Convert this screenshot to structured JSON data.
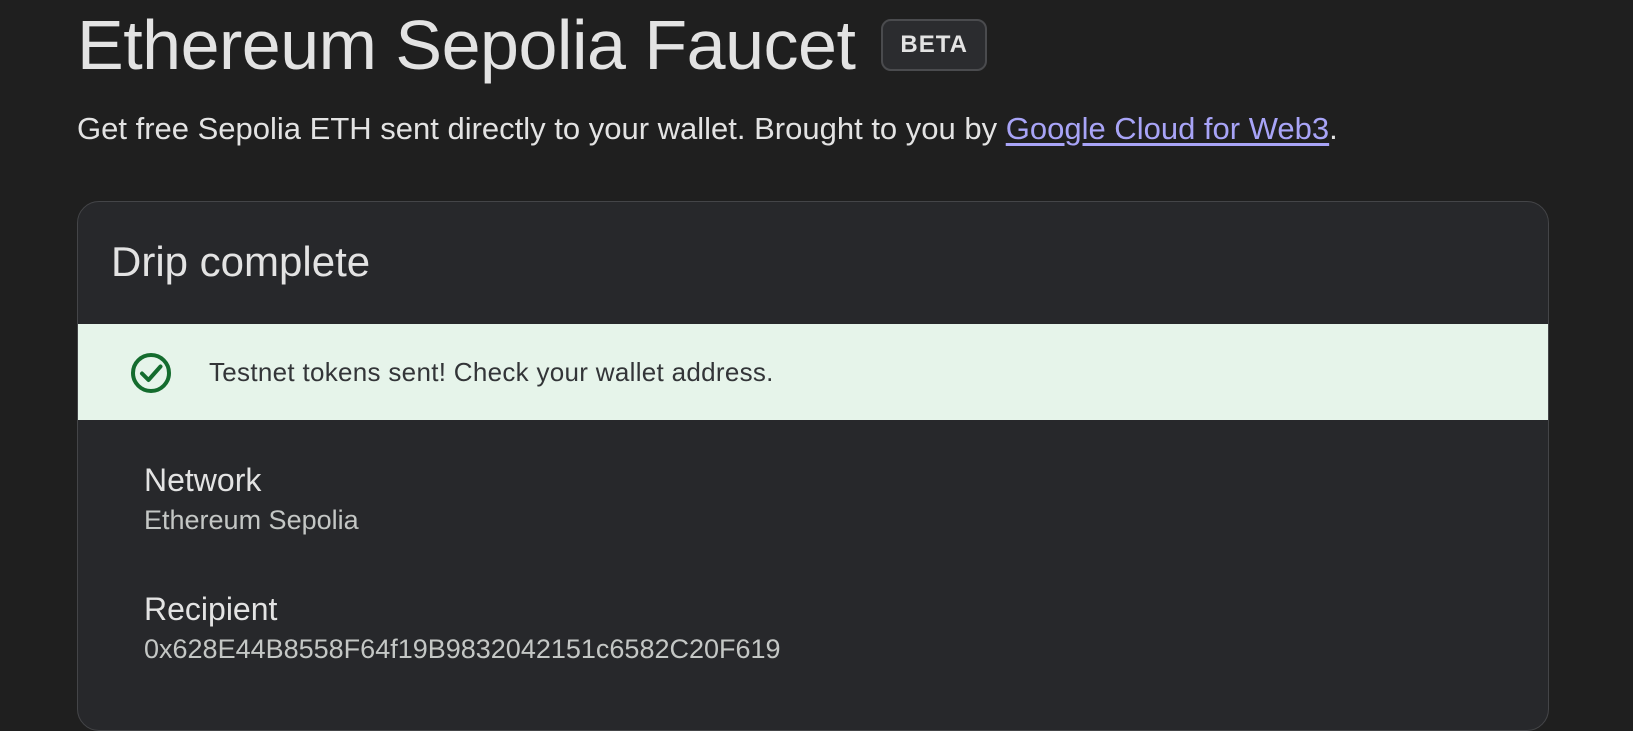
{
  "header": {
    "title": "Ethereum Sepolia Faucet",
    "badge": "BETA",
    "subtitle_prefix": "Get free Sepolia ETH sent directly to your wallet. Brought to you by ",
    "subtitle_link": "Google Cloud for Web3",
    "subtitle_suffix": "."
  },
  "card": {
    "title": "Drip complete",
    "banner": {
      "icon": "check-circle-icon",
      "message": "Testnet tokens sent! Check your wallet address."
    },
    "network": {
      "label": "Network",
      "value": "Ethereum Sepolia"
    },
    "recipient": {
      "label": "Recipient",
      "value": "0x628E44B8558F64f19B9832042151c6582C20F619"
    }
  },
  "colors": {
    "background": "#1f1f1f",
    "card_background": "#27282b",
    "link": "#a8a4f7",
    "success_background": "#e6f4ea",
    "success_icon": "#146c2e"
  }
}
